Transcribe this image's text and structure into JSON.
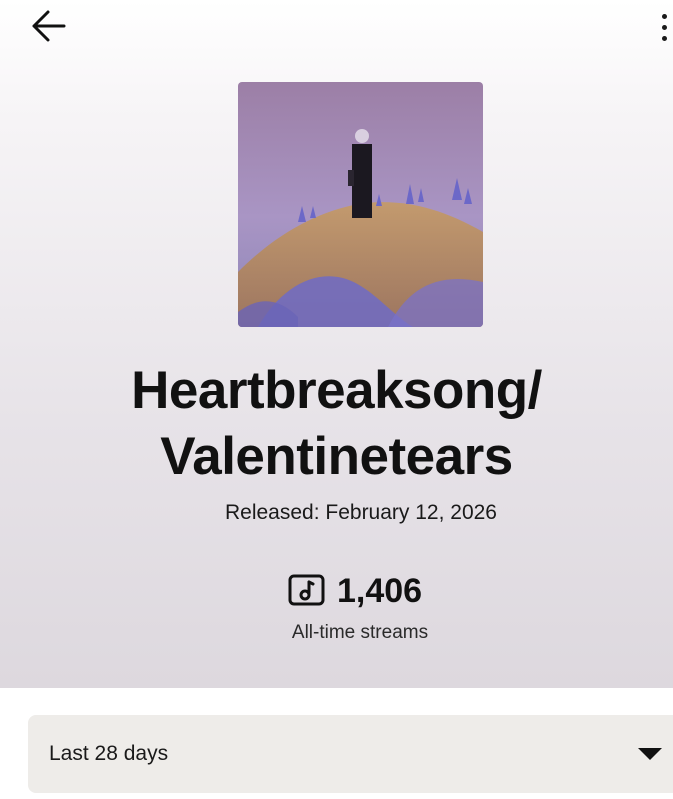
{
  "header": {
    "back_icon": "arrow-left-icon",
    "menu_icon": "more-vertical-icon"
  },
  "release": {
    "cover_alt": "Album cover",
    "title_line1": "Heartbreaksong/",
    "title_line2": "Valentinetears",
    "released_text": "Released: February 12, 2026"
  },
  "stats": {
    "streams_icon": "music-note-box-icon",
    "streams_value": "1,406",
    "streams_label": "All-time streams"
  },
  "filter": {
    "selected_range": "Last 28 days",
    "caret_icon": "caret-down-icon"
  },
  "colors": {
    "text_primary": "#121212",
    "select_background": "#eeece9",
    "hero_gradient_end": "#ddd8de"
  }
}
